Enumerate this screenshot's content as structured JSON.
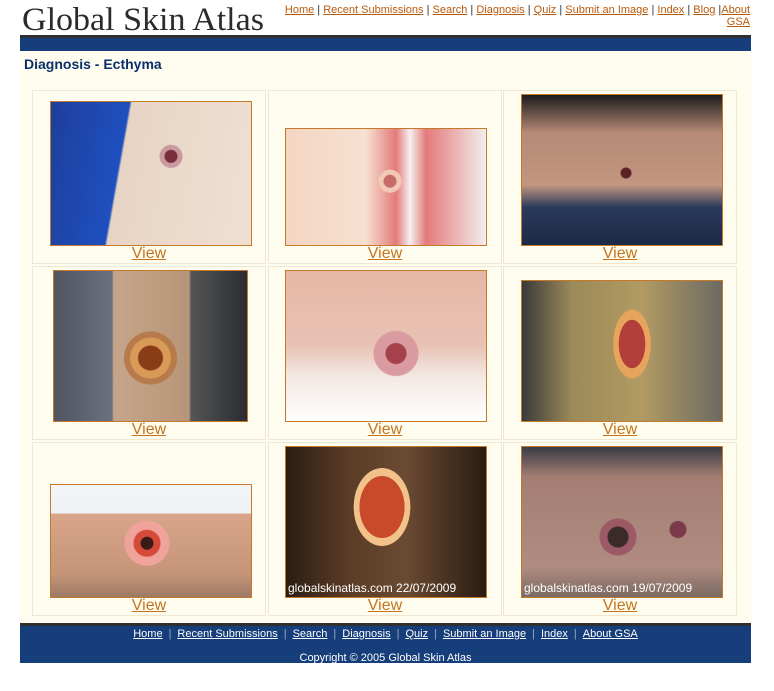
{
  "site": {
    "logo_text": "Global Skin Atlas"
  },
  "top_nav": [
    {
      "label": "Home"
    },
    {
      "label": "Recent Submissions"
    },
    {
      "label": "Search"
    },
    {
      "label": "Diagnosis"
    },
    {
      "label": "Quiz"
    },
    {
      "label": "Submit an Image"
    },
    {
      "label": "Index"
    },
    {
      "label": "Blog"
    },
    {
      "label": "About GSA"
    }
  ],
  "page": {
    "title": "Diagnosis - Ecthyma"
  },
  "gallery": [
    {
      "view_label": "View",
      "caption": ""
    },
    {
      "view_label": "View",
      "caption": ""
    },
    {
      "view_label": "View",
      "caption": ""
    },
    {
      "view_label": "View",
      "caption": ""
    },
    {
      "view_label": "View",
      "caption": ""
    },
    {
      "view_label": "View",
      "caption": ""
    },
    {
      "view_label": "View",
      "caption": ""
    },
    {
      "view_label": "View",
      "caption": "globalskinatlas.com 22/07/2009"
    },
    {
      "view_label": "View",
      "caption": "globalskinatlas.com 19/07/2009"
    }
  ],
  "footer": {
    "nav": [
      {
        "label": "Home"
      },
      {
        "label": "Recent Submissions"
      },
      {
        "label": "Search"
      },
      {
        "label": "Diagnosis"
      },
      {
        "label": "Quiz"
      },
      {
        "label": "Submit an Image"
      },
      {
        "label": "Index"
      },
      {
        "label": "About GSA"
      }
    ],
    "copyright": "Copyright © 2005 Global Skin Atlas"
  },
  "colors": {
    "brand_blue": "#153e7a",
    "link_orange": "#b85a0c",
    "panel_bg": "#fffdf0"
  }
}
